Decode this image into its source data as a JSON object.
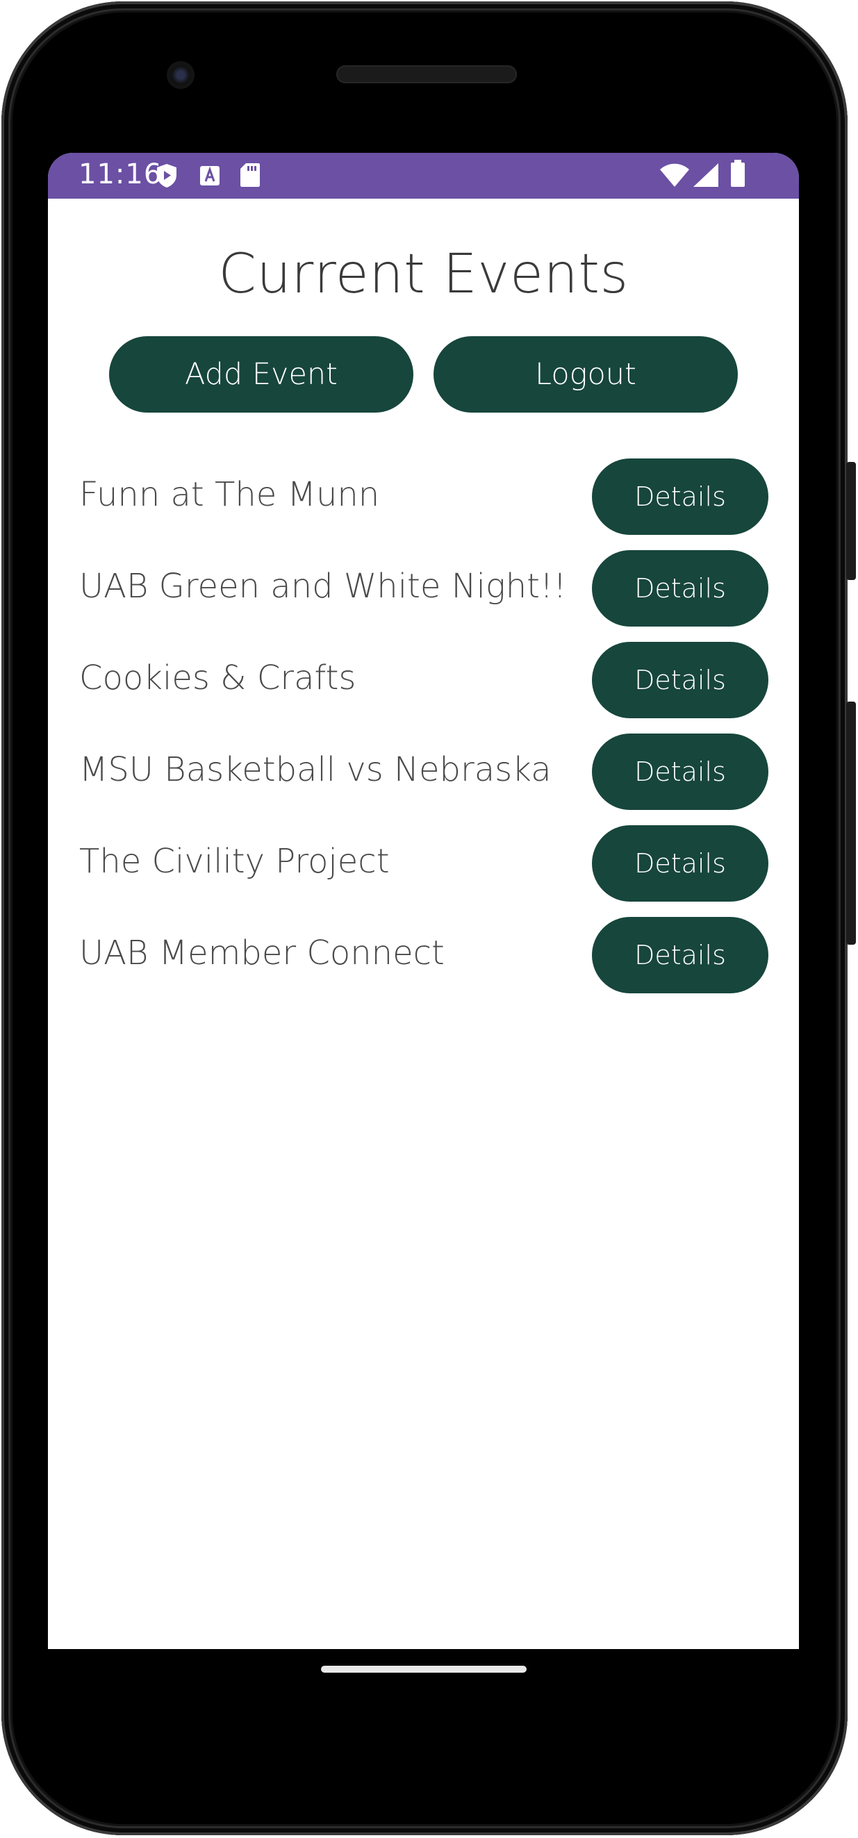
{
  "status_bar": {
    "time": "11:16",
    "left_icons": [
      "play-protect-icon",
      "font-a-icon",
      "sd-card-icon"
    ],
    "right_icons": [
      "wifi-icon",
      "signal-icon",
      "battery-icon"
    ],
    "color": "#6b50a4"
  },
  "page": {
    "title": "Current Events"
  },
  "actions": {
    "add_event_label": "Add Event",
    "logout_label": "Logout"
  },
  "events": [
    {
      "name": "Funn at The Munn",
      "details_label": "Details"
    },
    {
      "name": "UAB Green and White Night!!",
      "details_label": "Details"
    },
    {
      "name": "Cookies & Crafts",
      "details_label": "Details"
    },
    {
      "name": "MSU Basketball vs Nebraska",
      "details_label": "Details"
    },
    {
      "name": "The Civility Project",
      "details_label": "Details"
    },
    {
      "name": "UAB Member Connect",
      "details_label": "Details"
    }
  ],
  "colors": {
    "button_bg": "#17463c",
    "button_text": "#ffffff",
    "title_text": "#3a3a3a",
    "event_text": "#4a4a4a"
  }
}
